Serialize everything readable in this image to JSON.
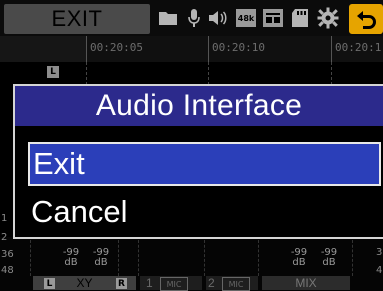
{
  "toolbar": {
    "exit_label": "EXIT",
    "icons": [
      "folder-icon",
      "microphone-icon",
      "speaker-icon",
      "sample-rate-icon",
      "file-format-icon",
      "sd-card-icon",
      "settings-icon",
      "back-icon"
    ],
    "sample_rate_text": "48k"
  },
  "timeline": {
    "times": [
      "00:20:05",
      "00:20:10",
      "00:20:1"
    ]
  },
  "track": {
    "left_badge": "L"
  },
  "meters": {
    "scale_top": "1",
    "scale_marks": [
      "2",
      "36",
      "48"
    ],
    "right_scale_marks": [
      "3",
      "4"
    ],
    "db_values": [
      {
        "value": "-99",
        "unit": "dB"
      },
      {
        "value": "-99",
        "unit": "dB"
      },
      {
        "value": "-99",
        "unit": "dB"
      },
      {
        "value": "-99",
        "unit": "dB"
      }
    ],
    "channels": {
      "xy": {
        "label": "XY",
        "left_tag": "L",
        "right_tag": "R"
      },
      "ch1": {
        "label": "1",
        "tag": "MIC"
      },
      "ch2": {
        "label": "2",
        "tag": "MIC"
      },
      "mix": {
        "label": "MIX",
        "left_tag": "L",
        "right_tag": "R"
      }
    }
  },
  "dialog": {
    "title": "Audio Interface",
    "options": [
      {
        "label": "Exit",
        "selected": true
      },
      {
        "label": "Cancel",
        "selected": false
      }
    ]
  },
  "colors": {
    "dialog_title_bg": "#2c2a8c",
    "selected_bg": "#2b3fb9",
    "back_button": "#e6a400"
  }
}
